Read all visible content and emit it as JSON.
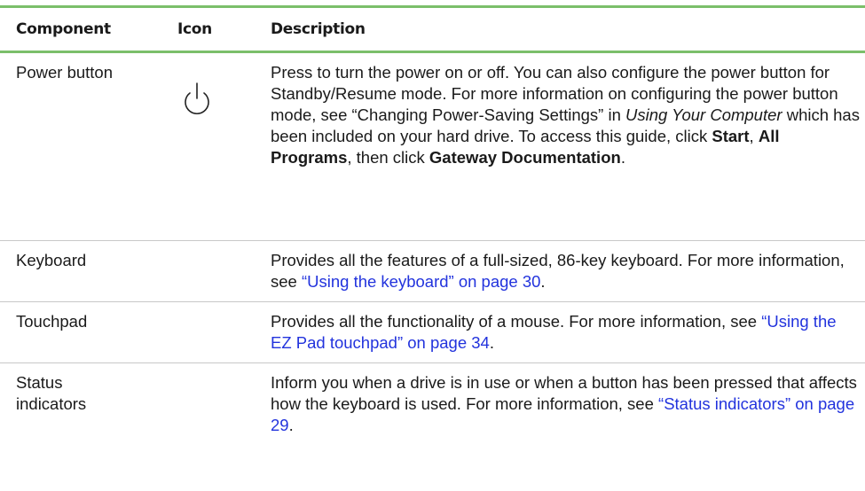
{
  "table": {
    "headers": {
      "component": "Component",
      "icon": "Icon",
      "description": "Description"
    },
    "rows": [
      {
        "component": "Power button",
        "icon": "power-icon",
        "desc": {
          "p1": "Press to turn the power on or off. You can also configure the power button for Standby/Resume mode. For more information on configuring the power button mode, see “Changing Power-Saving Settings” in ",
          "i1": "Using Your Computer",
          "p2": " which has been included on your hard drive. To access this guide, click ",
          "b1": "Start",
          "p3": ", ",
          "b2": "All Programs",
          "p4": ", then click ",
          "b3": "Gateway Documentation",
          "p5": "."
        }
      },
      {
        "component": "Keyboard",
        "desc": {
          "p1": "Provides all the features of a full-sized, 86-key keyboard. For more information, see ",
          "link": "“Using the keyboard” on page 30",
          "p2": "."
        }
      },
      {
        "component": "Touchpad",
        "desc": {
          "p1": "Provides all the functionality of a mouse. For more information, see ",
          "link": "“Using the EZ Pad touchpad” on page 34",
          "p2": "."
        }
      },
      {
        "component": "Status indicators",
        "desc": {
          "p1": "Inform you when a drive is in use or when a button has been pressed that affects how the keyboard is used. For more information, see ",
          "link": "“Status indicators” on page 29",
          "p2": "."
        }
      }
    ]
  },
  "colors": {
    "rule": "#7bbf6a",
    "link": "#2233dd",
    "text": "#1a1a1a"
  }
}
